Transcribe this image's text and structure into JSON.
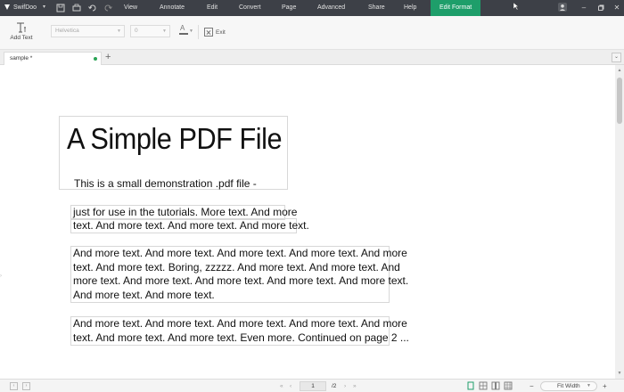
{
  "app": {
    "name": "SwifDoo"
  },
  "menu": {
    "items": [
      "View",
      "Annotate",
      "Edit",
      "Convert",
      "Page",
      "Advanced",
      "Share",
      "Help",
      "Edit Format"
    ],
    "active": "Edit Format"
  },
  "toolbar": {
    "add_text_label": "Add Text",
    "font_family": "Helvetica",
    "font_size": "0",
    "font_color_glyph": "A",
    "exit_label": "Exit"
  },
  "tabs": {
    "document_tab": "sample *",
    "add_tab_glyph": "+"
  },
  "document": {
    "title": "A Simple PDF File",
    "subtitle": "This is a small demonstration .pdf file -",
    "block1": [
      "just for use in the tutorials. More text. And more",
      "text. And more text. And more text. And more text."
    ],
    "block2": [
      "And more text. And more text. And more text. And more text. And more",
      "text. And more text. Boring, zzzzz. And more text. And more text. And",
      "more text. And more text. And more text. And more text. And more text.",
      "And more text. And more text."
    ],
    "block3": [
      "And more text. And more text. And more text. And more text. And more",
      "text. And more text. And more text. Even more. Continued on page 2 ..."
    ]
  },
  "statusbar": {
    "current_page": "1",
    "total_pages": "/2",
    "zoom": "Fit Width",
    "zoom_out": "−",
    "zoom_in": "+"
  },
  "colors": {
    "titlebar": "#3d4047",
    "accent": "#1e9e6a",
    "modified_dot": "#2aa455"
  },
  "icons": {
    "logo": "swifdoo-logo-icon",
    "save": "save-icon",
    "print": "print-icon",
    "undo": "undo-icon",
    "redo": "redo-icon",
    "cursor": "cursor-icon",
    "account": "account-icon",
    "add_text": "text-cursor-icon",
    "exit": "close-box-icon"
  }
}
